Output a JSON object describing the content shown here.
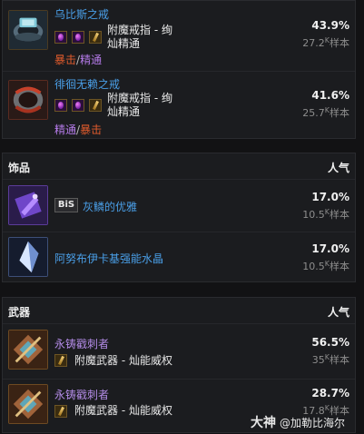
{
  "rings": [
    {
      "name": "乌比斯之戒",
      "enchant_line1": "附魔戒指 - 绚",
      "enchant_line2": "灿精通",
      "popularity": "43.9%",
      "samples_value": "27.2",
      "samples_unit": "K",
      "samples_suffix": "样本",
      "stat1": "暴击",
      "stat2": "精通"
    },
    {
      "name": "徘徊无赖之戒",
      "enchant_line1": "附魔戒指 - 绚",
      "enchant_line2": "灿精通",
      "popularity": "41.6%",
      "samples_value": "25.7",
      "samples_unit": "K",
      "samples_suffix": "样本",
      "stat1": "精通",
      "stat2": "暴击"
    }
  ],
  "stat_separator": "/",
  "trinkets": {
    "title": "饰品",
    "column": "人气",
    "items": [
      {
        "badge": "BiS",
        "name": "灰鳞的优雅",
        "popularity": "17.0%",
        "samples_value": "10.5",
        "samples_unit": "K",
        "samples_suffix": "样本"
      },
      {
        "name": "阿努布伊卡基强能水晶",
        "popularity": "17.0%",
        "samples_value": "10.5",
        "samples_unit": "K",
        "samples_suffix": "样本"
      }
    ]
  },
  "weapons": {
    "title": "武器",
    "column": "人气",
    "items": [
      {
        "name": "永铸戳刺者",
        "enchant": "附魔武器 - 灿能威权",
        "popularity": "56.5%",
        "samples_value": "35",
        "samples_unit": "K",
        "samples_suffix": "样本"
      },
      {
        "name": "永铸戳刺者",
        "enchant": "附魔武器 - 灿能威权",
        "popularity": "28.7%",
        "samples_value": "17.8",
        "samples_unit": "K",
        "samples_suffix": "样本"
      }
    ]
  },
  "watermark": {
    "brand": "大神",
    "handle": "@加勒比海尔"
  }
}
